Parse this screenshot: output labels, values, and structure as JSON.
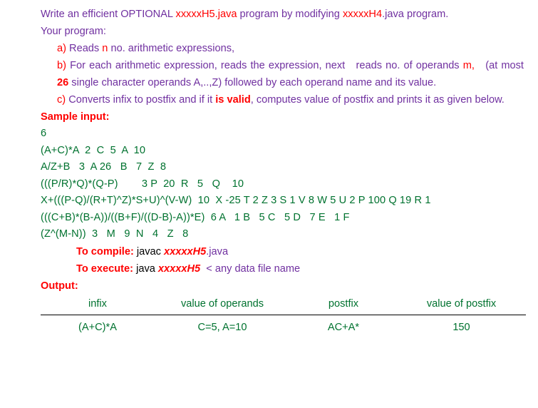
{
  "document": {
    "intro": {
      "seg1": "Write an efficient OPTIONAL ",
      "seg2": "xxxxxH5.java",
      "seg3": " program by modifying ",
      "seg4": "xxxxxH4",
      "seg5": ".java program.",
      "line2": "Your program:"
    },
    "items": {
      "a_label": "a)",
      "a_text1": " Reads ",
      "a_var": "n",
      "a_text2": " no. arithmetic expressions,",
      "b_label": "b)",
      "b_text1": " For each arithmetic expression, reads the expression, next   reads no. of operands ",
      "b_var1": "m,",
      "b_text2": "   (at most ",
      "b_var2": "26",
      "b_text3": " single character operands A,..,Z) followed by each operand name and its value.",
      "c_label": "c)",
      "c_text1": " Converts infix to postfix and if it ",
      "c_em": "is valid",
      "c_text2": ", computes value of postfix and prints it as given below."
    },
    "sample_input": {
      "label": "Sample input:",
      "count": "6",
      "lines": [
        "(A+C)*A  2  C  5  A  10",
        "A/Z+B   3  A 26   B   7  Z  8",
        "(((P/R)*Q)*(Q-P)        3 P  20  R   5   Q    10",
        "X+(((P-Q)/(R+T)^Z)*S+U)^(V-W)  10  X -25 T 2 Z 3 S 1 V 8 W 5 U 2 P 100 Q 19 R 1",
        "(((C+B)*(B-A))/((B+F)/((D-B)-A))*E)  6 A   1 B   5 C   5 D   7 E   1 F",
        "(Z^(M-N))  3   M   9  N   4   Z   8"
      ]
    },
    "commands": {
      "compile_label": "To compile:",
      "compile_tool": " javac ",
      "compile_file": "xxxxxH5",
      "compile_ext": ".java",
      "execute_label": "To execute:",
      "execute_tool": " java ",
      "execute_file": "xxxxxH5",
      "execute_rest": "  < any data file name"
    },
    "output": {
      "label": "Output:",
      "headers": [
        "infix",
        "value of operands",
        "postfix",
        "value of postfix"
      ],
      "rows": [
        {
          "infix": "(A+C)*A",
          "value_of_operands": "C=5, A=10",
          "postfix": "AC+A*",
          "value_of_postfix": "150"
        }
      ]
    },
    "colors": {
      "purple": "#7030A0",
      "red": "#FF0000",
      "green": "#00722F",
      "black": "#000000",
      "rule": "#000000"
    }
  }
}
